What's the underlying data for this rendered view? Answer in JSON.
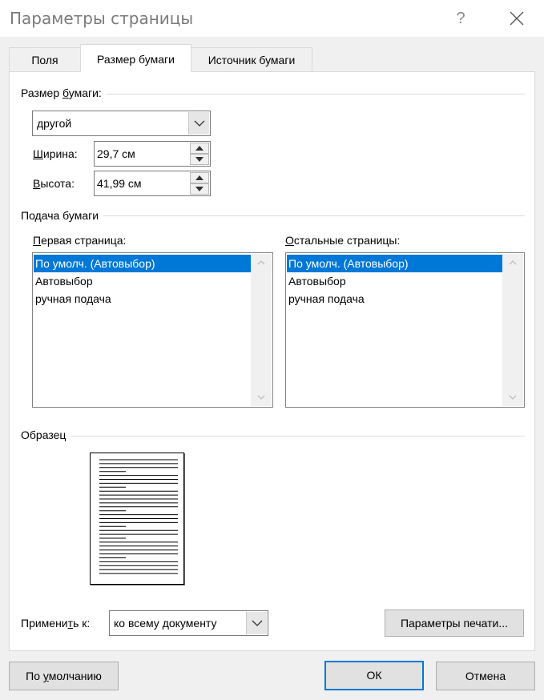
{
  "window": {
    "title": "Параметры страницы",
    "help": "?"
  },
  "tabs": [
    {
      "label": "Поля"
    },
    {
      "label": "Размер бумаги"
    },
    {
      "label": "Источник бумаги"
    }
  ],
  "paper_size": {
    "group_label_pre": "Размер ",
    "group_label_u": "б",
    "group_label_post": "умаги:",
    "selected": "другой",
    "width_label_u": "Ш",
    "width_label_rest": "ирина:",
    "width_value": "29,7 см",
    "height_label_u": "В",
    "height_label_rest": "ысота:",
    "height_value": "41,99 см"
  },
  "paper_source": {
    "group_label": "Подача бумаги",
    "first_page_label_u": "П",
    "first_page_label_rest": "ервая страница:",
    "other_pages_label_u": "О",
    "other_pages_label_rest": "стальные страницы:",
    "first_page_items": [
      "По умолч. (Автовыбор)",
      "Автовыбор",
      "ручная подача"
    ],
    "other_pages_items": [
      "По умолч. (Автовыбор)",
      "Автовыбор",
      "ручная подача"
    ]
  },
  "preview": {
    "group_label": "Образец"
  },
  "apply": {
    "label_pre": "Примени",
    "label_u": "т",
    "label_post": "ь к:",
    "selected": "ко всему документу"
  },
  "buttons": {
    "print_options": "Параметры печати...",
    "default_pre": "По ",
    "default_u": "у",
    "default_post": "молчанию",
    "ok": "ОК",
    "cancel": "Отмена"
  }
}
